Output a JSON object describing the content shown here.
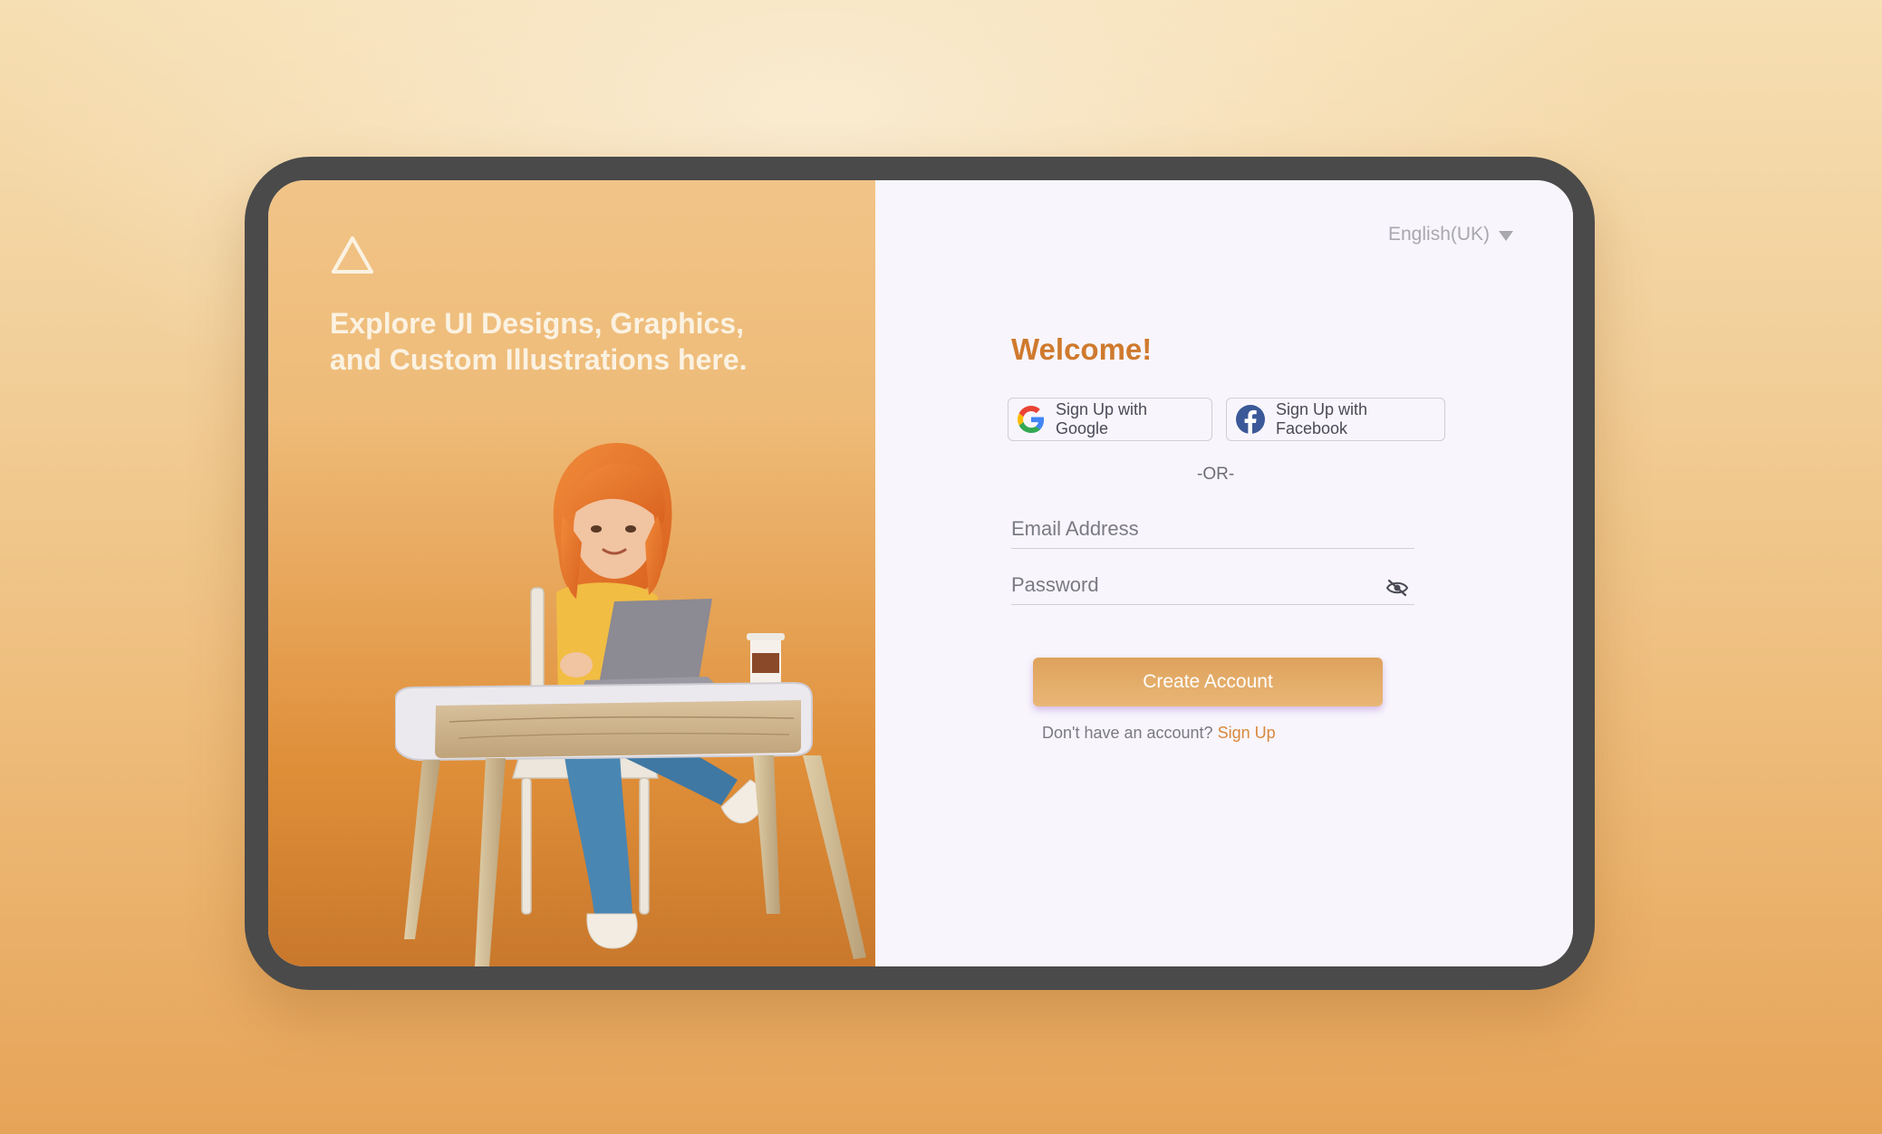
{
  "brand": {
    "tagline_line1": "Explore UI Designs, Graphics,",
    "tagline_line2": "and Custom Illustrations here.",
    "logo_icon": "triangle-logo-icon"
  },
  "language": {
    "selected": "English(UK)",
    "icon": "caret-down-icon"
  },
  "form": {
    "heading": "Welcome!",
    "google_label": "Sign Up with Google",
    "facebook_label": "Sign Up with Facebook",
    "divider": "-OR-",
    "email_placeholder": "Email Address",
    "password_placeholder": "Password",
    "password_toggle_icon": "eye-off-icon",
    "submit_label": "Create Account",
    "footer_text": "Don't have an account?",
    "footer_link": "Sign Up"
  },
  "colors": {
    "accent": "#cf7a2e",
    "button": "#e3a864",
    "left_panel": "#e8a85d",
    "device_frame": "#4a4a4a",
    "form_bg": "#f8f5fc"
  }
}
